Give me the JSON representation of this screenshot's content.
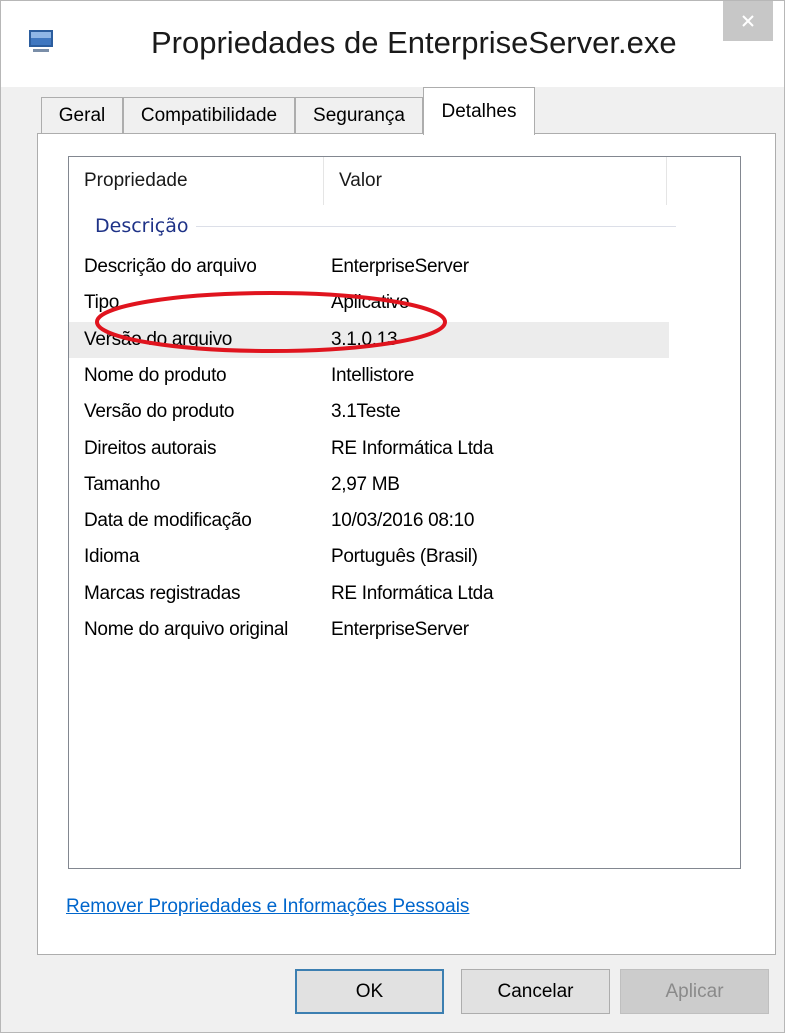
{
  "window": {
    "title": "Propriedades de EnterpriseServer.exe",
    "close_icon": "close-icon"
  },
  "tabs": [
    {
      "label": "Geral",
      "active": false
    },
    {
      "label": "Compatibilidade",
      "active": false
    },
    {
      "label": "Segurança",
      "active": false
    },
    {
      "label": "Detalhes",
      "active": true
    }
  ],
  "details": {
    "columns": [
      "Propriedade",
      "Valor"
    ],
    "group": "Descrição",
    "rows": [
      {
        "property": "Descrição do arquivo",
        "value": "EnterpriseServer"
      },
      {
        "property": "Tipo",
        "value": "Aplicativo"
      },
      {
        "property": "Versão do arquivo",
        "value": "3.1.0.13"
      },
      {
        "property": "Nome do produto",
        "value": "Intellistore"
      },
      {
        "property": "Versão do produto",
        "value": "3.1Teste"
      },
      {
        "property": "Direitos autorais",
        "value": "RE Informática Ltda"
      },
      {
        "property": "Tamanho",
        "value": "2,97 MB"
      },
      {
        "property": "Data de modificação",
        "value": "10/03/2016 08:10"
      },
      {
        "property": "Idioma",
        "value": "Português (Brasil)"
      },
      {
        "property": "Marcas registradas",
        "value": "RE Informática Ltda"
      },
      {
        "property": "Nome do arquivo original",
        "value": "EnterpriseServer"
      }
    ],
    "highlighted_row": 2,
    "annotation_color": "#e0141e"
  },
  "link": {
    "label": "Remover Propriedades e Informações Pessoais"
  },
  "buttons": {
    "ok": "OK",
    "cancel": "Cancelar",
    "apply": "Aplicar"
  }
}
